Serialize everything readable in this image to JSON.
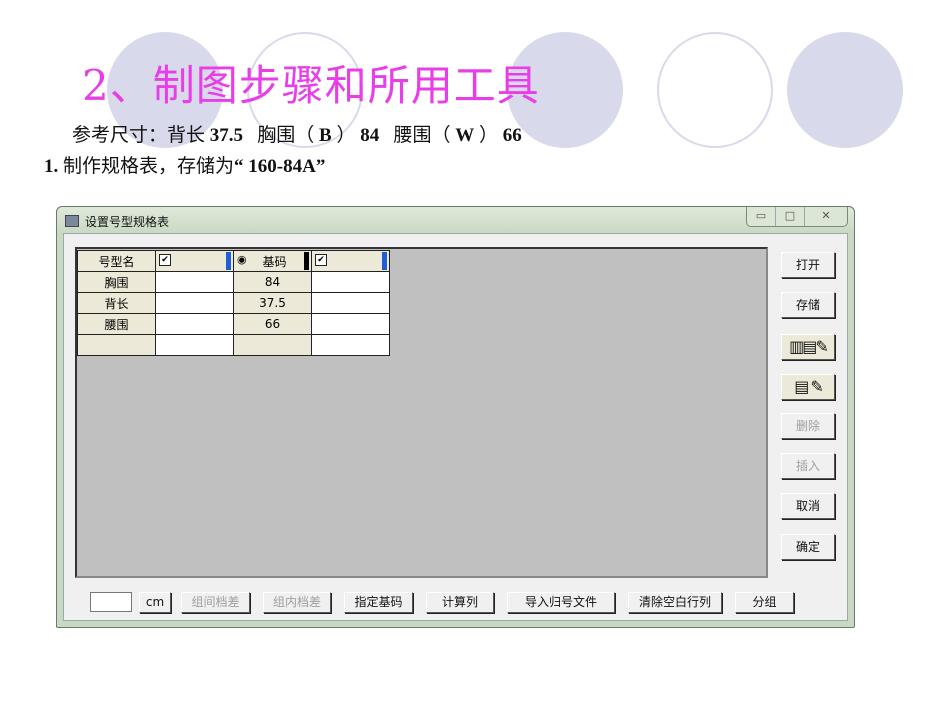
{
  "slide": {
    "title": "2、制图步骤和所用工具",
    "ref_prefix": "参考尺寸：背长",
    "back_length": "37.5",
    "chest_label": "胸围（",
    "chest_B": "B",
    "chest_close": "）",
    "chest_value": "84",
    "waist_label": "腰围（",
    "waist_W": "W",
    "waist_close": "）",
    "waist_value": "66",
    "step_num": "1.",
    "step_text": "制作规格表，存储为",
    "step_file": "“ 160-84A”"
  },
  "dialog": {
    "title": "设置号型规格表",
    "min": "▭",
    "max": "□",
    "close": "✕",
    "table": {
      "header": [
        "号型名",
        "",
        "基码",
        ""
      ],
      "rows": [
        {
          "name": "胸围",
          "base": "84"
        },
        {
          "name": "背长",
          "base": "37.5"
        },
        {
          "name": "腰围",
          "base": "66"
        },
        {
          "name": "",
          "base": ""
        }
      ]
    },
    "right_buttons": {
      "open": "打开",
      "save": "存储",
      "delete": "删除",
      "insert": "插入",
      "cancel": "取消",
      "ok": "确定"
    },
    "bottom": {
      "unit": "cm",
      "inter_group": "组间档差",
      "intra_group": "组内档差",
      "set_base": "指定基码",
      "calc_col": "计算列",
      "import": "导入归号文件",
      "clear_empty": "清除空白行列",
      "group": "分组"
    }
  }
}
